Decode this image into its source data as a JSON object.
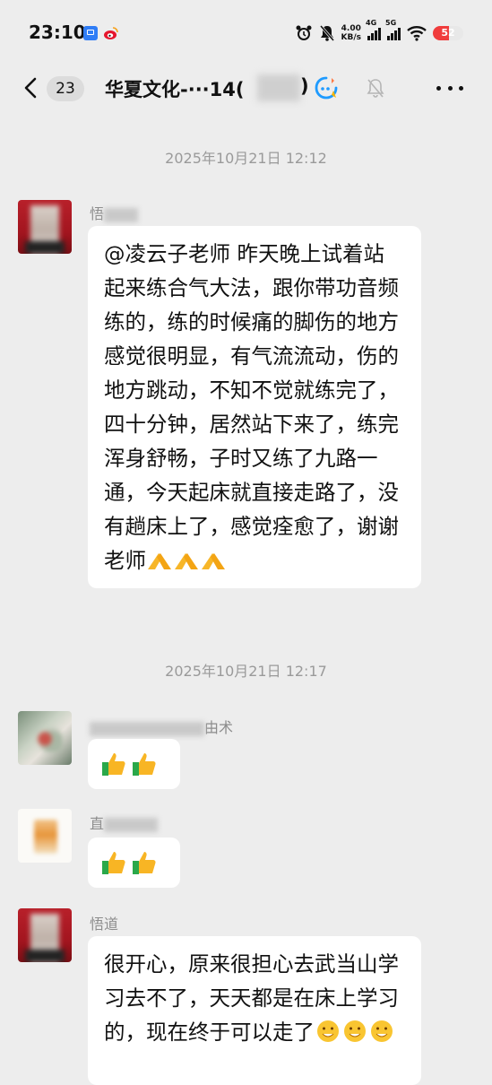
{
  "status_bar": {
    "time": "23:10",
    "net_speed_value": "4.00",
    "net_speed_unit": "KB/s",
    "signal_1": "4G",
    "signal_2": "5G",
    "battery": "52"
  },
  "nav": {
    "unread_count": "23",
    "title": "华夏文化-···14(",
    "title_end": ")"
  },
  "messages": [
    {
      "timestamp": "2025年10月21日 12:12",
      "sender": "悟",
      "text": "@凌云子老师  昨天晚上试着站起来练合气大法，跟你带功音频练的，练的时候痛的脚伤的地方感觉很明显，有气流流动，伤的地方跳动，不知不觉就练完了，四十分钟，居然站下来了，练完浑身舒畅，子时又练了九路一通，今天起床就直接走路了，没有趟床上了，感觉痊愈了，谢谢老师",
      "trailing_emoji": "pray-x3"
    },
    {
      "timestamp": "2025年10月21日 12:17",
      "sender": "由术",
      "emoji": "thumbs-up-x2"
    },
    {
      "sender": "直",
      "emoji": "thumbs-up-x2"
    },
    {
      "sender": "悟道",
      "text": "很开心，原来很担心去武当山学习去不了，天天都是在床上学习的，现在终于可以走了",
      "trailing_emoji": "smile-x3"
    }
  ],
  "colors": {
    "background": "#ededed",
    "bubble": "#ffffff",
    "timestamp": "#9a9a9a",
    "sender": "#8c8c8c",
    "battery_red": "#f03c3c",
    "qq_blue": "#1e9bff"
  }
}
